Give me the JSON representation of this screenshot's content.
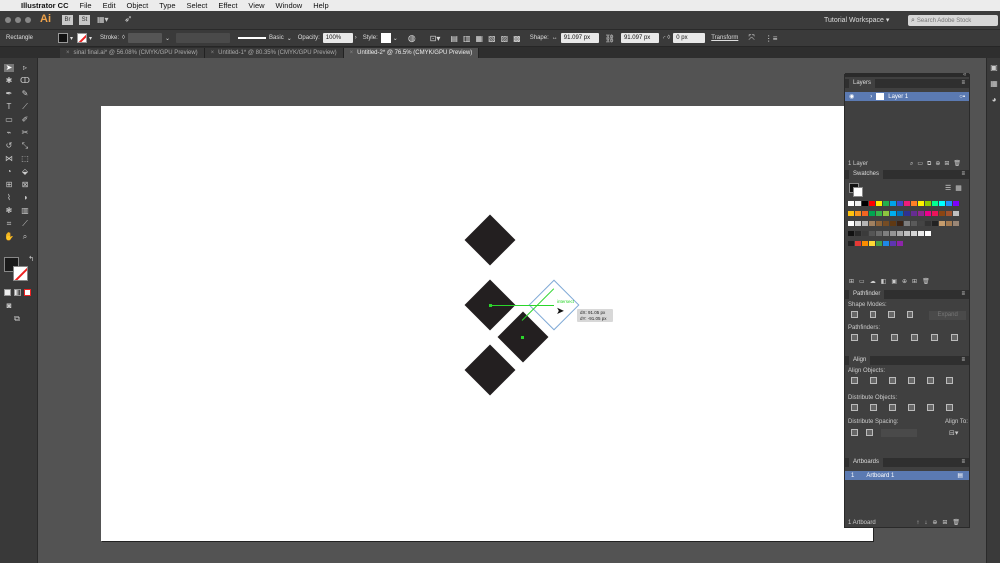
{
  "menubar": {
    "apple": "",
    "app": "Illustrator CC",
    "items": [
      "File",
      "Edit",
      "Object",
      "Type",
      "Select",
      "Effect",
      "View",
      "Window",
      "Help"
    ]
  },
  "appbar": {
    "logo": "Ai",
    "br": "Br",
    "st": "St",
    "workspace": "Tutorial Workspace",
    "search_placeholder": "Search Adobe Stock"
  },
  "control": {
    "tool_name": "Rectangle",
    "stroke_label": "Stroke:",
    "brush_label": "Basic",
    "opacity_label": "Opacity:",
    "opacity_value": "100%",
    "style_label": "Style:",
    "shape_label": "Shape:",
    "width_value": "91.097 px",
    "height_value": "91.097 px",
    "corner_value": "0 px",
    "transform_label": "Transform"
  },
  "tabs": [
    {
      "label": "sinal final.ai* @ 56.08% (CMYK/GPU Preview)",
      "active": false
    },
    {
      "label": "Untitled-1* @ 80.35% (CMYK/GPU Preview)",
      "active": false
    },
    {
      "label": "Untitled-2* @ 76.5% (CMYK/GPU Preview)",
      "active": true
    }
  ],
  "canvas": {
    "smart_guide": "intersect",
    "tooltip_dx": "dX: 91.05 px",
    "tooltip_dy": "dY: -91.05 px"
  },
  "layers": {
    "title": "Layers",
    "layer_name": "Layer 1",
    "count": "1 Layer"
  },
  "swatches": {
    "title": "Swatches"
  },
  "pathfinder": {
    "title": "Pathfinder",
    "shape_modes": "Shape Modes:",
    "expand": "Expand",
    "pathfinders": "Pathfinders:"
  },
  "align": {
    "title": "Align",
    "align_objects": "Align Objects:",
    "distribute_objects": "Distribute Objects:",
    "distribute_spacing": "Distribute Spacing:",
    "align_to": "Align To:"
  },
  "artboards": {
    "title": "Artboards",
    "item_num": "1",
    "item_name": "Artboard 1",
    "count": "1 Artboard"
  },
  "colors": {
    "accent": "#5b8fd6",
    "selection_blue": "#7fa9d6",
    "guide_green": "#2bd52b",
    "shape_fill": "#231f20"
  }
}
